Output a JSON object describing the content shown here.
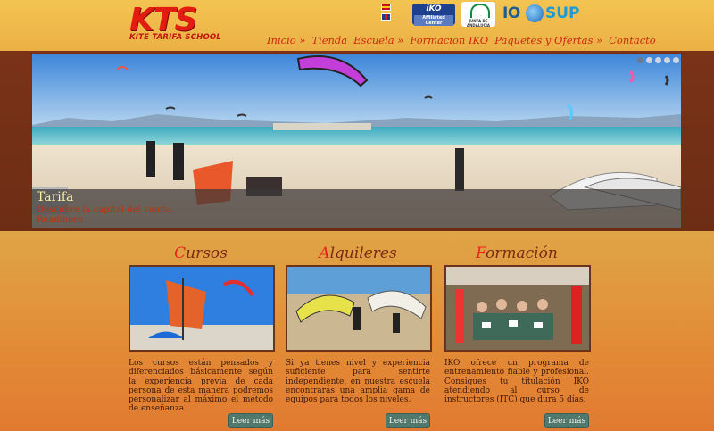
{
  "logo": {
    "name": "KTS",
    "tagline": "KITE TARIFA SCHOOL"
  },
  "languages": [
    "es-flag-icon",
    "uk-flag-icon"
  ],
  "partners": {
    "iko_main": "iKO",
    "iko_sub": "Affiliated Center",
    "junta": "JUNTA DE ANDALUCIA",
    "io": "IO",
    "sup": "SUP"
  },
  "nav": [
    {
      "label": "Inicio »"
    },
    {
      "label": "Tienda"
    },
    {
      "label": "Escuela »"
    },
    {
      "label": "Formacion IKO"
    },
    {
      "label": "Paquetes y Ofertas »"
    },
    {
      "label": "Contacto"
    }
  ],
  "slider": {
    "title": "Tarifa",
    "description": "Descubre la capital del viento",
    "link": "Readmore",
    "total_slides": 5,
    "active_slide": 1
  },
  "columns": [
    {
      "title_first": "C",
      "title_rest": "ursos",
      "text": "Los cursos están pensados y diferenciados básicamente según la experiencia previa de cada persona de esta manera podremos personalizar al máximo el método de enseñanza.",
      "button": "Leer más"
    },
    {
      "title_first": "A",
      "title_rest": "lquileres",
      "text": "Si ya tienes nivel y experiencia suficiente para sentirte independiente, en nuestra escuela encontrarás una amplia gama de equipos para todos los niveles.",
      "button": "Leer más"
    },
    {
      "title_first": "F",
      "title_rest": "ormación",
      "text": "IKO ofrece un programa de entrenamiento fiable y profesional. Consigues tu titulación IKO atendiendo al curso de instructores (ITC) que dura 5 días.",
      "button": "Leer más"
    }
  ]
}
